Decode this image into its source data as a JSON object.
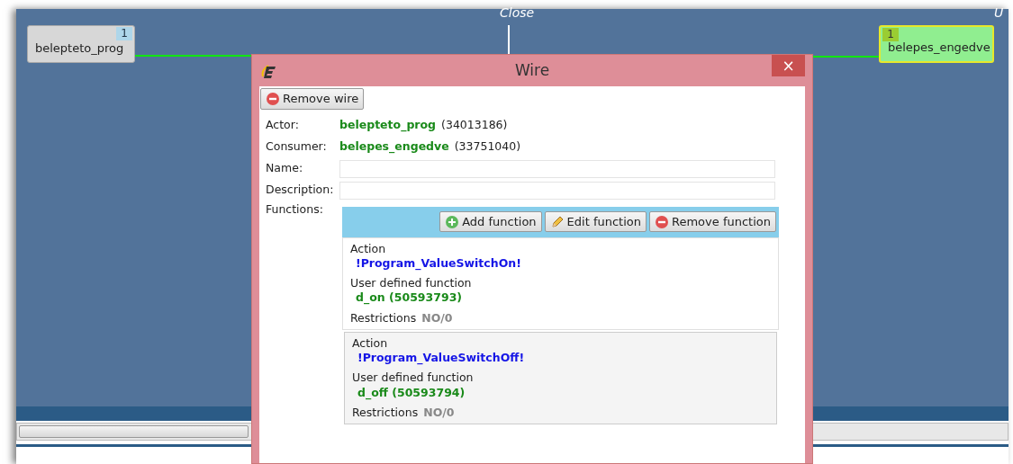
{
  "canvas": {
    "header_labels": [
      "Close",
      "U"
    ],
    "nodes": [
      {
        "label": "belepteto_prog",
        "count": "1",
        "selected": false
      },
      {
        "label": "belepes_engedve",
        "count": "1",
        "selected": true
      }
    ]
  },
  "dialog": {
    "title": "Wire",
    "close": "×",
    "remove_button": "Remove wire",
    "fields": [
      {
        "kind": "link",
        "label": "Actor:",
        "value": "belepteto_prog",
        "id_text": "(34013186)"
      },
      {
        "kind": "link",
        "label": "Consumer:",
        "value": "belepes_engedve",
        "id_text": "(33751040)"
      },
      {
        "kind": "input",
        "label": "Name:"
      },
      {
        "kind": "input",
        "label": "Description:"
      }
    ],
    "functions_label": "Functions:",
    "toolbar": [
      {
        "kind": "add",
        "label": "Add function"
      },
      {
        "kind": "edit",
        "label": "Edit function"
      },
      {
        "kind": "remove",
        "label": "Remove function"
      }
    ],
    "functions": [
      {
        "action_label": "Action",
        "action": "!Program_ValueSwitchOn!",
        "udf_label": "User defined function",
        "udf": "d_on (50593793)",
        "restrictions_label": "Restrictions",
        "restrictions": "NO/0",
        "selected": false
      },
      {
        "action_label": "Action",
        "action": "!Program_ValueSwitchOff!",
        "udf_label": "User defined function",
        "udf": "d_off (50593794)",
        "restrictions_label": "Restrictions",
        "restrictions": "NO/0",
        "selected": true
      }
    ]
  }
}
